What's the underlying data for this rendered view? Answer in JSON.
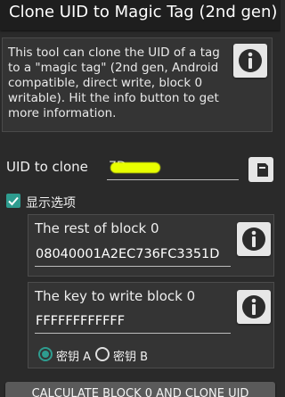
{
  "title": "Clone UID to Magic Tag (2nd gen)",
  "info_text": "This tool can clone the UID of a tag to a \"magic tag\" (2nd gen, Android compatible, direct write, block 0 writable). Hit the info button to get more information.",
  "uid": {
    "label": "UID to clone",
    "value": "7D"
  },
  "options": {
    "checkbox_label": "显示选项",
    "checked": true
  },
  "block0": {
    "title": "The rest of block 0",
    "value": "08040001A2EC736FC3351D"
  },
  "key": {
    "title": "The key to write block 0",
    "value": "FFFFFFFFFFFF",
    "radio_a": "密钥 A",
    "radio_b": "密钥 B",
    "selected": "A"
  },
  "action_button": "CALCULATE BLOCK 0 AND CLONE UID",
  "icons": {
    "info": "info-icon",
    "paste": "paste-icon",
    "check": "check-icon"
  },
  "colors": {
    "accent": "#2e9c8f",
    "background": "#2a2a2a",
    "title_bar": "#1e1e1e",
    "redaction": "#e8ff00"
  }
}
